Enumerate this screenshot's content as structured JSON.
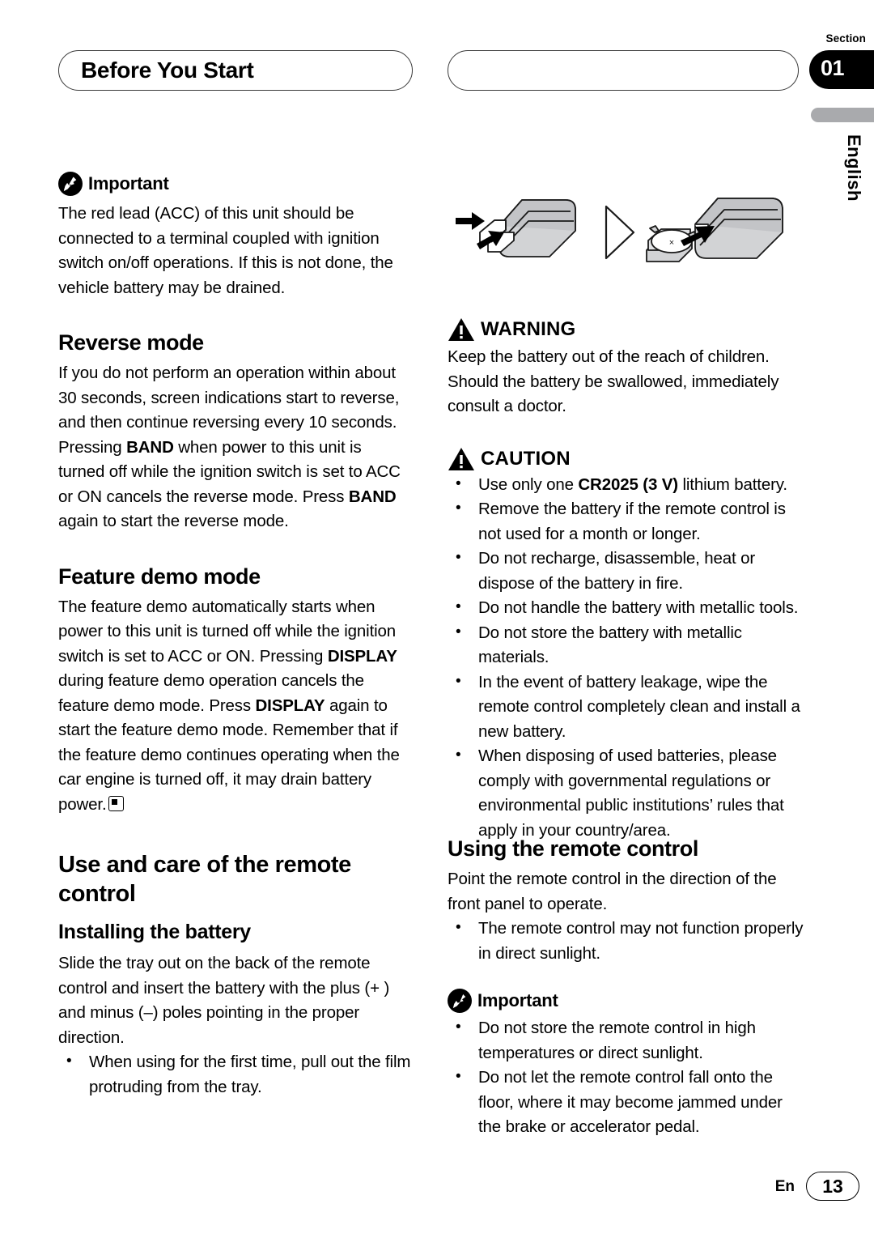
{
  "header": {
    "title": "Before You Start",
    "section_label": "Section",
    "section_number": "01",
    "language": "English"
  },
  "left_column": {
    "important": {
      "icon": "pushpin-icon",
      "label": "Important",
      "text": "The red lead (ACC) of this unit should be connected to a terminal coupled with ignition switch on/off operations. If this is not done, the vehicle battery may be drained."
    },
    "reverse_mode": {
      "heading": "Reverse mode",
      "text_part1": "If you do not perform an operation within about 30 seconds, screen indications start to reverse, and then continue reversing every 10 seconds. Pressing ",
      "key1": "BAND",
      "text_part2": " when power to this unit is turned off while the ignition switch is set to ACC or ON cancels the reverse mode. Press ",
      "key2": "BAND",
      "text_part3": " again to start the reverse mode."
    },
    "feature_demo_mode": {
      "heading": "Feature demo mode",
      "text_part1": "The feature demo automatically starts when power to this unit is turned off while the ignition switch is set to ACC or ON. Pressing ",
      "key1": "DISPLAY",
      "text_part2": " during feature demo operation cancels the feature demo mode. Press ",
      "key2": "DISPLAY",
      "text_part3": " again to start the feature demo mode. Remember that if the feature demo continues operating when the car engine is turned off, it may drain battery power."
    },
    "remote_care": {
      "heading": "Use and care of the remote control",
      "subheading": "Installing the battery",
      "text": "Slide the tray out on the back of the remote control and insert the battery with the plus (+ ) and minus (–) poles pointing in the proper direction.",
      "bullets": [
        "When using for the first time, pull out the film protruding from the tray."
      ]
    }
  },
  "right_column": {
    "illustration": {
      "name": "remote-control-battery-installation-diagram",
      "battery_marking": "×"
    },
    "warning": {
      "icon": "warning-triangle-icon",
      "label": "WARNING",
      "text": "Keep the battery out of the reach of children. Should the battery be swallowed, immediately consult a doctor."
    },
    "caution": {
      "icon": "warning-triangle-icon",
      "label": "CAUTION",
      "bullets": [
        {
          "pre": "Use only one ",
          "bold": "CR2025 (3 V)",
          "post": " lithium battery."
        },
        {
          "pre": "Remove the battery if the remote control is not used for a month or longer.",
          "bold": "",
          "post": ""
        },
        {
          "pre": "Do not recharge, disassemble, heat or dispose of the battery in fire.",
          "bold": "",
          "post": ""
        },
        {
          "pre": "Do not handle the battery with metallic tools.",
          "bold": "",
          "post": ""
        },
        {
          "pre": "Do not store the battery with metallic materials.",
          "bold": "",
          "post": ""
        },
        {
          "pre": "In the event of battery leakage, wipe the remote control completely clean and install a new battery.",
          "bold": "",
          "post": ""
        },
        {
          "pre": "When disposing of used batteries, please comply with governmental regulations or environmental public institutions’ rules that apply in your country/area.",
          "bold": "",
          "post": ""
        }
      ]
    },
    "using_remote": {
      "heading": "Using the remote control",
      "text": "Point the remote control in the direction of the front panel to operate.",
      "bullets": [
        "The remote control may not function properly in direct sunlight."
      ]
    },
    "important": {
      "icon": "pushpin-icon",
      "label": "Important",
      "bullets": [
        "Do not store the remote control in high temperatures or direct sunlight.",
        "Do not let the remote control fall onto the floor, where it may become jammed under the brake or accelerator pedal."
      ]
    }
  },
  "footer": {
    "language_code": "En",
    "page_number": "13"
  },
  "colors": {
    "ink": "#000000",
    "gray_bar": "#a9aaad",
    "illustration_fill": "#d2d3d5",
    "rule": "#3a3a3a"
  }
}
